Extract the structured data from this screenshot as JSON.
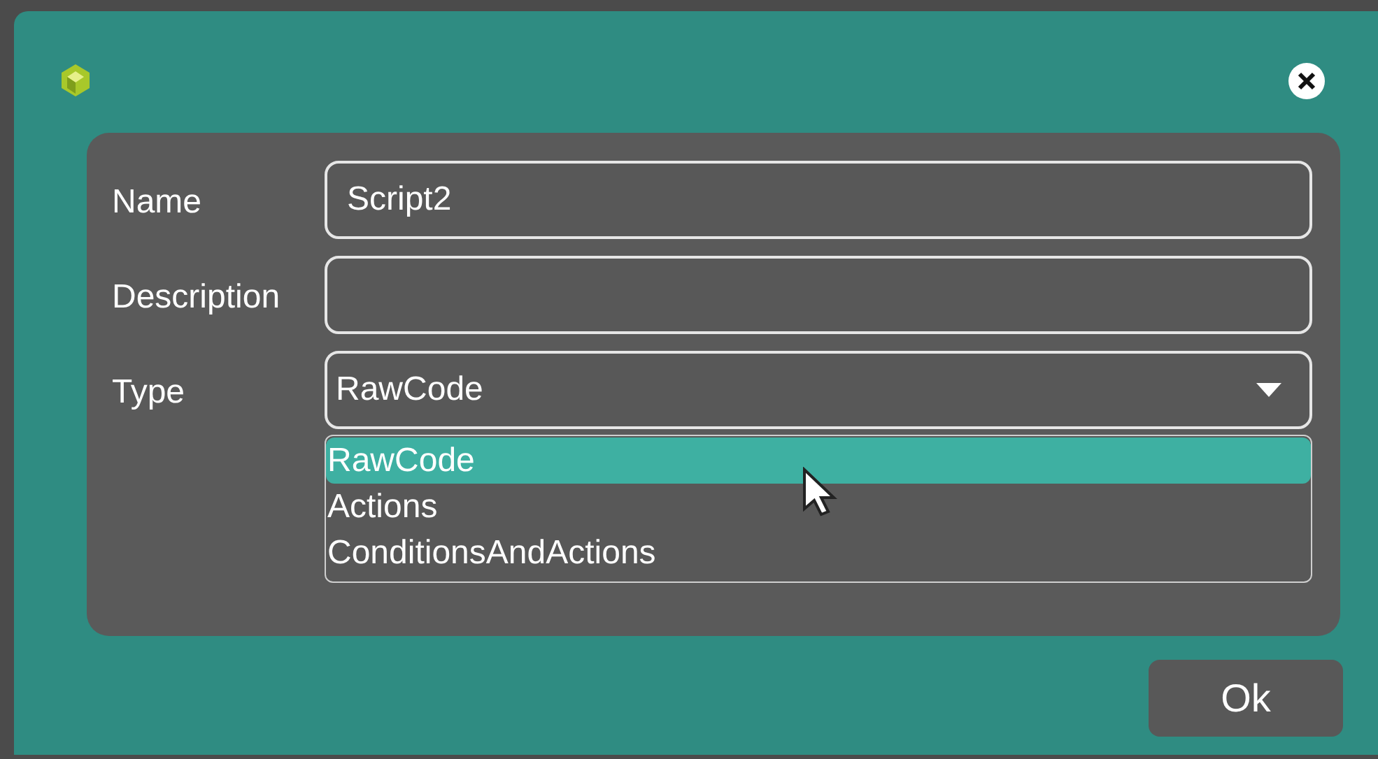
{
  "fields": [
    {
      "label": "Name",
      "kind": "text",
      "value": "Script2"
    },
    {
      "label": "Description",
      "kind": "text"
    },
    {
      "label": "Type",
      "kind": "select",
      "value": "RawCode",
      "expanded": true,
      "options": [
        {
          "label": "RawCode",
          "selected": true
        },
        {
          "label": "Actions",
          "selected": false
        },
        {
          "label": "ConditionsAndActions",
          "selected": false
        }
      ]
    }
  ],
  "buttons": [
    {
      "label": "Ok"
    }
  ]
}
